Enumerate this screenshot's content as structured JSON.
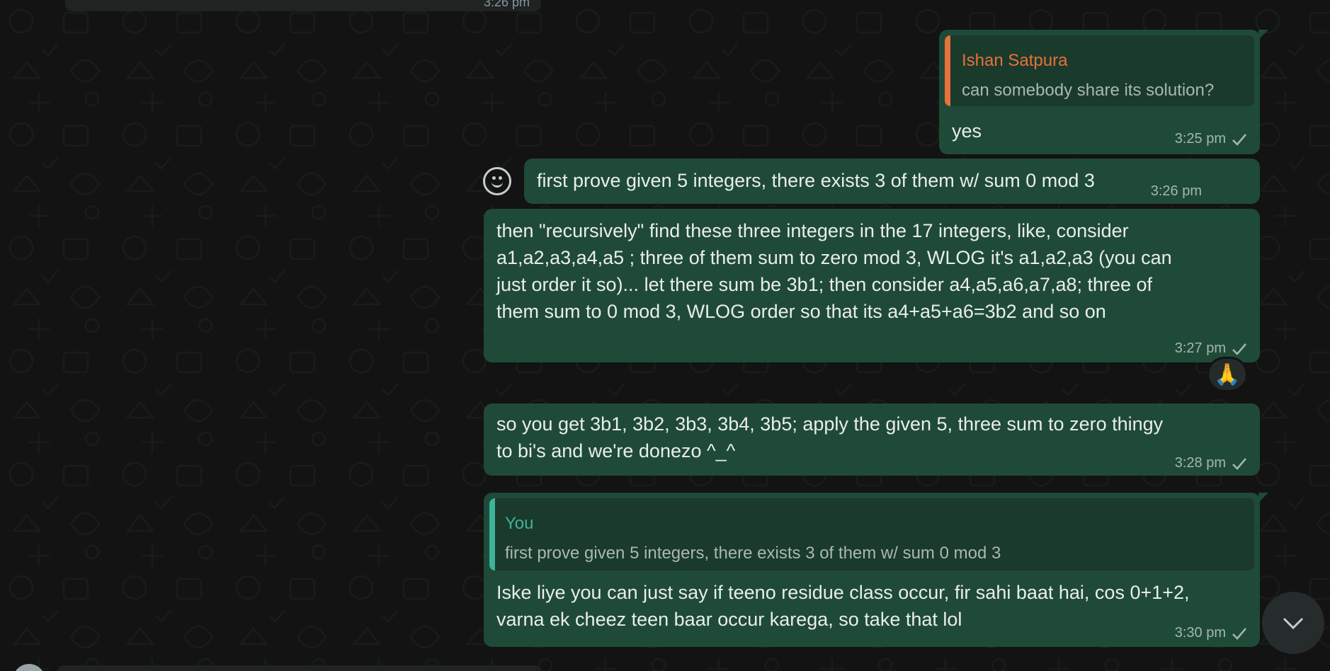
{
  "theme": {
    "bubble_out": "#1f4a37",
    "quote_bg": "#1a3a2c",
    "meta_color": "#a3b7ae",
    "accent_orange": "#e8703a",
    "accent_teal": "#3fb39a",
    "background": "#121312"
  },
  "top_partial": {
    "time": "3:26 pm"
  },
  "messages": [
    {
      "reply": {
        "name": "Ishan Satpura",
        "text": "can somebody share its solution?"
      },
      "text": "yes",
      "time": "3:25 pm"
    },
    {
      "text": "first prove given 5 integers, there exists 3 of them w/ sum 0 mod 3",
      "time": "3:26 pm"
    },
    {
      "text": "then \"recursively\" find these three integers in the 17 integers, like, consider\na1,a2,a3,a4,a5 ; three of them sum to zero mod 3, WLOG it's a1,a2,a3 (you can\njust order it so)... let there sum be 3b1; then consider a4,a5,a6,a7,a8; three of\nthem sum to 0 mod 3, WLOG order so that its a4+a5+a6=3b2 and so on",
      "time": "3:27 pm",
      "reaction": "🙏"
    },
    {
      "text": "so you get 3b1, 3b2, 3b3, 3b4, 3b5; apply the given 5, three sum to zero thingy\nto bi's and we're donezo ^_^",
      "time": "3:28 pm"
    },
    {
      "reply": {
        "name": "You",
        "text": "first prove given 5 integers, there exists 3 of them w/ sum 0 mod 3"
      },
      "text": "Iske liye you can just say if teeno residue class occur, fir sahi baat hai, cos 0+1+2,\nvarna ek cheez teen baar occur karega, so take that lol",
      "time": "3:30 pm"
    }
  ],
  "icons": {
    "tick": "single-check-icon",
    "emoji": "smiley-reaction-icon",
    "menu": "chevron-down-icon",
    "scroll": "scroll-to-bottom-icon"
  }
}
